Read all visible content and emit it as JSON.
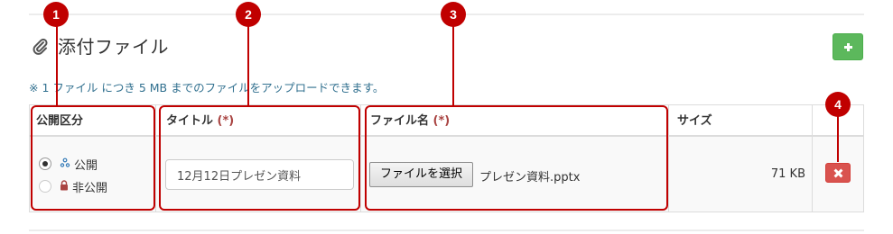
{
  "section": {
    "heading": "添付ファイル",
    "note": "※ 1 ファイル につき 5 MB までのファイルをアップロードできます。"
  },
  "icons": {
    "attach": "paperclip-icon",
    "add": "plus-icon",
    "public": "people-icon",
    "private": "lock-icon",
    "delete": "times-icon"
  },
  "table": {
    "headers": {
      "visibility": "公開区分",
      "title": "タイトル",
      "file_name": "ファイル名",
      "required_mark": "(*)",
      "size": "サイズ"
    },
    "row": {
      "visibility_options": [
        {
          "label": "公開",
          "selected": true
        },
        {
          "label": "非公開",
          "selected": false
        }
      ],
      "title_value": "12月12日プレゼン資料",
      "file_button": "ファイルを選択",
      "file_name": "プレゼン資料.pptx",
      "size": "71 KB"
    }
  },
  "callouts": [
    "1",
    "2",
    "3",
    "4"
  ],
  "colors": {
    "add_button": "#5cb85c",
    "delete_button": "#d9534f",
    "callout": "#c00000",
    "note": "#31708f",
    "required": "#a94442"
  }
}
